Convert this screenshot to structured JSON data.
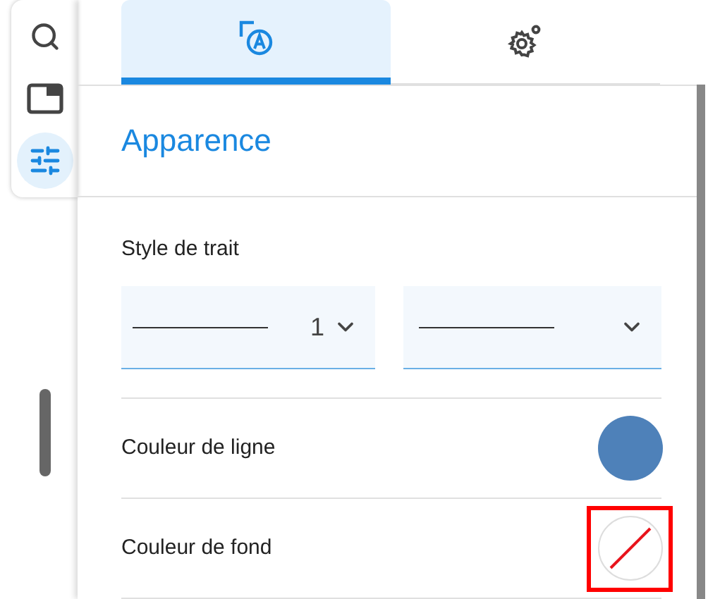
{
  "toolbar": [
    {
      "kind": "search",
      "selected": false
    },
    {
      "kind": "window",
      "selected": false
    },
    {
      "kind": "sliders",
      "selected": true
    }
  ],
  "tabs": [
    {
      "kind": "appearance",
      "selected": true
    },
    {
      "kind": "settings",
      "selected": false
    }
  ],
  "section_title": "Apparence",
  "stroke_style": {
    "label": "Style de trait",
    "width_select": {
      "value": "1"
    },
    "dash_select": {
      "kind": "solid"
    }
  },
  "colors": [
    {
      "label": "Couleur de ligne",
      "kind": "swatch",
      "color": "#4e81b9",
      "highlighted": false
    },
    {
      "label": "Couleur de fond",
      "kind": "none",
      "highlighted": true
    }
  ]
}
